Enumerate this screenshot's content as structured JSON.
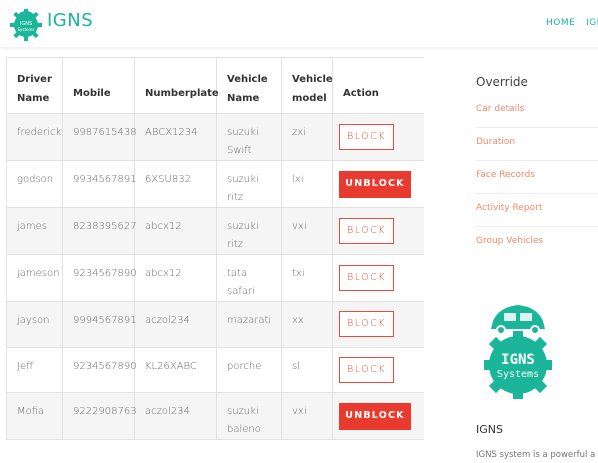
{
  "header": {
    "brand": "IGNS",
    "logo_text": [
      "IGNS",
      "Systems"
    ],
    "nav": [
      "HOME",
      "IGI"
    ],
    "accent": "#1bb59a"
  },
  "table": {
    "columns": [
      [
        "Driver",
        "Name"
      ],
      [
        "",
        "Mobile"
      ],
      [
        "",
        "Numberplate"
      ],
      [
        "Vehicle",
        "Name"
      ],
      [
        "Vehicle",
        "model"
      ],
      [
        "",
        "Action"
      ]
    ],
    "rows": [
      {
        "driver": "frederick",
        "mobile": "9987615438",
        "plate": "ABCX1234",
        "vehicle": [
          "suzuki",
          "Swift"
        ],
        "model": "zxi",
        "action": "BLOCK"
      },
      {
        "driver": "godson",
        "mobile": "9934567891",
        "plate": "6XSU832",
        "vehicle": [
          "suzuki ritz",
          ""
        ],
        "model": "lxi",
        "action": "UNBLOCK"
      },
      {
        "driver": "james",
        "mobile": "8238395627",
        "plate": "abcx12",
        "vehicle": [
          "suzuki ritz",
          ""
        ],
        "model": "vxi",
        "action": "BLOCK"
      },
      {
        "driver": "jameson",
        "mobile": "9234567890",
        "plate": "abcx12",
        "vehicle": [
          "tata safari",
          ""
        ],
        "model": "txi",
        "action": "BLOCK"
      },
      {
        "driver": "jayson",
        "mobile": "9994567891",
        "plate": "aczol234",
        "vehicle": [
          "mazarati",
          ""
        ],
        "model": "xx",
        "action": "BLOCK"
      },
      {
        "driver": "Jeff",
        "mobile": "9234567890",
        "plate": "KL26XABC",
        "vehicle": [
          "porche",
          ""
        ],
        "model": "sl",
        "action": "BLOCK"
      },
      {
        "driver": "Mofia",
        "mobile": "9222908763",
        "plate": "aczol234",
        "vehicle": [
          "suzuki",
          "baleno"
        ],
        "model": "vxi",
        "action": "UNBLOCK"
      }
    ],
    "block_color": "#e74c3c"
  },
  "sidebar": {
    "title": "Override",
    "links": [
      "Car details",
      "Duration",
      "Face Records",
      "Activity Report",
      "Group Vehicles"
    ],
    "link_color": "#f08a6c",
    "name": "IGNS",
    "description": "IGNS system is a powerful a"
  }
}
